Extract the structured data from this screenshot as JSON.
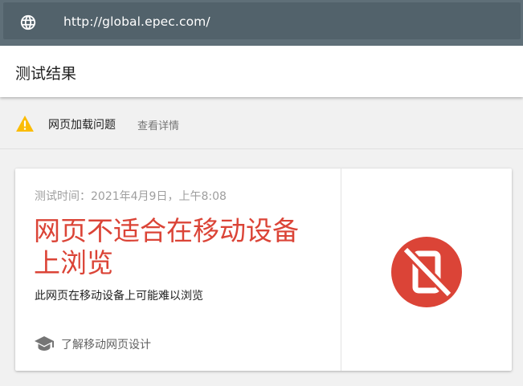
{
  "browser": {
    "url": "http://global.epec.com/",
    "icon": "globe-icon"
  },
  "header": {
    "title": "测试结果"
  },
  "issues": {
    "icon": "warning-icon",
    "label": "网页加载问题",
    "link": "查看详情"
  },
  "result": {
    "timestamp": "测试时间：2021年4月9日，上午8:08",
    "title": "网页不适合在移动设备上浏览",
    "description": "此网页在移动设备上可能难以浏览",
    "learn_more": "了解移动网页设计",
    "learn_icon": "graduation-cap-icon",
    "status_icon": "not-mobile-friendly-icon"
  },
  "colors": {
    "url_bar": "#5f6f78",
    "warning": "#fbbc05",
    "error": "#db4437"
  }
}
